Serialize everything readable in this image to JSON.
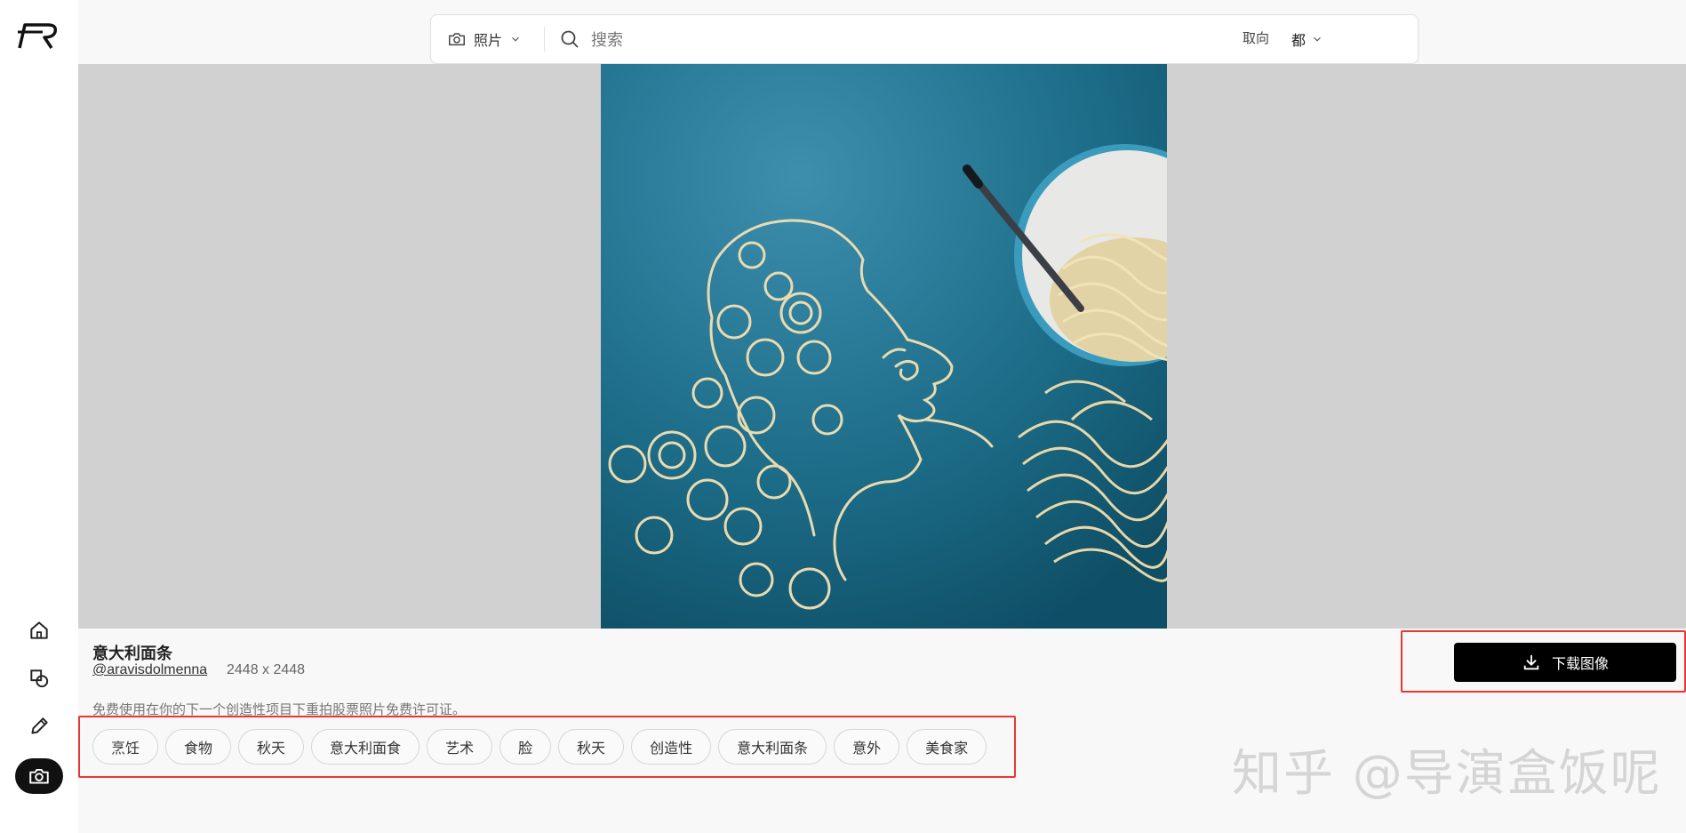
{
  "search": {
    "type_label": "照片",
    "placeholder": "搜索",
    "orientation_label": "取向",
    "orientation_value": "都"
  },
  "photo": {
    "title": "意大利面条",
    "author": "@aravisdolmenna",
    "dimensions": "2448 x 2448",
    "license": "免费使用在你的下一个创造性项目下重拍股票照片免费许可证。"
  },
  "tags": [
    "烹饪",
    "食物",
    "秋天",
    "意大利面食",
    "艺术",
    "脸",
    "秋天",
    "创造性",
    "意大利面条",
    "意外",
    "美食家"
  ],
  "download": {
    "label": "下载图像"
  },
  "watermark": "知乎 @导演盒饭呢",
  "colors": {
    "accent": "#000000",
    "highlight": "#e53935",
    "photo_bg": "#1d6b86"
  }
}
